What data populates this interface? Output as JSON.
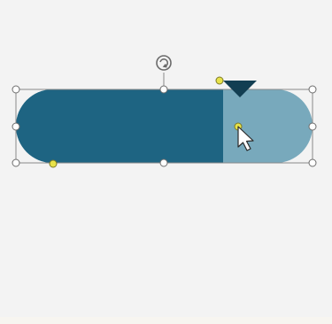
{
  "canvas": {
    "background": "#f3f3f3",
    "bottom_strip": "#f7f5f0"
  },
  "shape": {
    "type": "rounded-rectangle-progress",
    "fill_color": "#1e6482",
    "track_color": "#78a9bc",
    "marker_color": "#123e52",
    "progress_fraction": 0.7
  },
  "selection": {
    "frame_color": "#8a8a8a",
    "handle_fill": "#ffffff",
    "handle_stroke": "#6d6d6d",
    "adjust_handle_fill": "#e8e34a",
    "adjust_handle_stroke": "#7d7a27"
  },
  "icons": {
    "rotate": "rotate-icon",
    "cursor": "arrow-cursor-icon",
    "marker": "triangle-marker-icon"
  }
}
